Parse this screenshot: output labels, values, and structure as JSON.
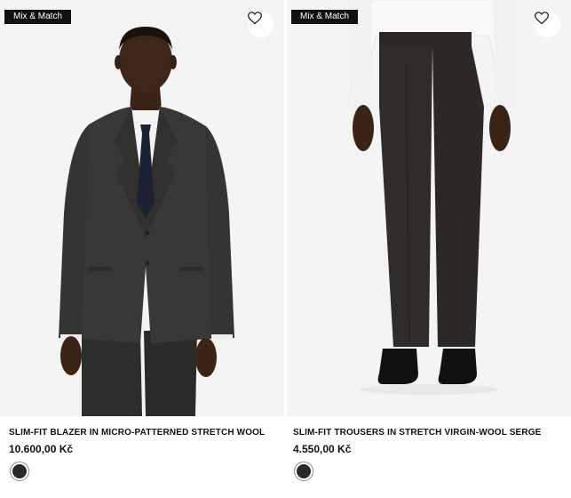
{
  "products": [
    {
      "badge": "Mix & Match",
      "name": "SLIM-FIT BLAZER IN MICRO-PATTERNED STRETCH WOOL",
      "price": "10.600,00 Kč",
      "swatch_color": "#2a2a2a",
      "wishlist_icon": "heart-icon"
    },
    {
      "badge": "Mix & Match",
      "name": "SLIM-FIT TROUSERS IN STRETCH VIRGIN-WOOL SERGE",
      "price": "4.550,00 Kč",
      "swatch_color": "#2a2a2a",
      "wishlist_icon": "heart-icon"
    }
  ]
}
